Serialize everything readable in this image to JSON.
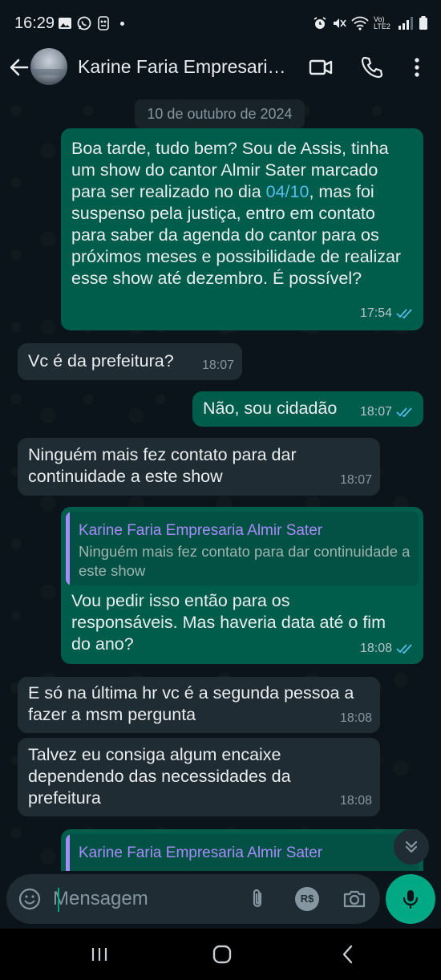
{
  "status_bar": {
    "time": "16:29",
    "network_label": "Vo) LTE2"
  },
  "header": {
    "contact_name": "Karine Faria Empresari…"
  },
  "chat": {
    "date_chip": "10 de outubro de 2024",
    "messages": [
      {
        "direction": "outgoing",
        "text_before_link": "Boa tarde, tudo bem? Sou de Assis, tinha um show do cantor Almir Sater marcado para ser realizado no dia ",
        "link_text": "04/10",
        "text_after_link": ", mas foi suspenso pela justiça, entro em contato para saber da agenda do cantor para os próximos meses e possibilidade de realizar esse show até dezembro. É possível?",
        "time": "17:54",
        "status": "read"
      },
      {
        "direction": "incoming",
        "text": "Vc é da prefeitura?",
        "time": "18:07"
      },
      {
        "direction": "outgoing",
        "text": "Não, sou cidadão",
        "time": "18:07",
        "status": "read"
      },
      {
        "direction": "incoming",
        "text": "Ninguém mais fez contato para dar continuidade a este show",
        "time": "18:07"
      },
      {
        "direction": "outgoing",
        "quote": {
          "author": "Karine Faria Empresaria Almir Sater",
          "text": "Ninguém mais fez contato para dar continuidade a este show"
        },
        "text": "Vou pedir isso então para os responsáveis. Mas haveria data até o fim do ano?",
        "time": "18:08",
        "status": "read"
      },
      {
        "direction": "incoming",
        "text": "E só na última hr vc é a segunda pessoa a fazer a msm pergunta",
        "time": "18:08"
      },
      {
        "direction": "incoming",
        "text": "Talvez eu consiga algum encaixe dependendo das necessidades da prefeitura",
        "time": "18:08"
      },
      {
        "direction": "outgoing",
        "quote": {
          "author": "Karine Faria Empresaria Almir Sater"
        },
        "partial": true
      }
    ]
  },
  "input": {
    "placeholder": "Mensagem",
    "payment_icon_label": "R$"
  },
  "colors": {
    "background": "#0b141a",
    "outgoing_bubble": "#005c4b",
    "incoming_bubble": "#202c33",
    "accent": "#00a884",
    "quote_author": "#a78bfa",
    "read_ticks": "#53bdeb"
  },
  "icons": {
    "status_bar": [
      "gallery-icon",
      "whatsapp-icon",
      "app-icon",
      "alarm-icon",
      "mute-icon",
      "wifi-icon",
      "signal-icon",
      "battery-icon"
    ],
    "header": [
      "back-arrow-icon",
      "video-call-icon",
      "phone-icon",
      "more-options-icon"
    ],
    "input": [
      "emoji-icon",
      "attach-icon",
      "payment-icon",
      "camera-icon",
      "mic-icon"
    ],
    "nav": [
      "recents-icon",
      "home-icon",
      "back-icon"
    ]
  }
}
